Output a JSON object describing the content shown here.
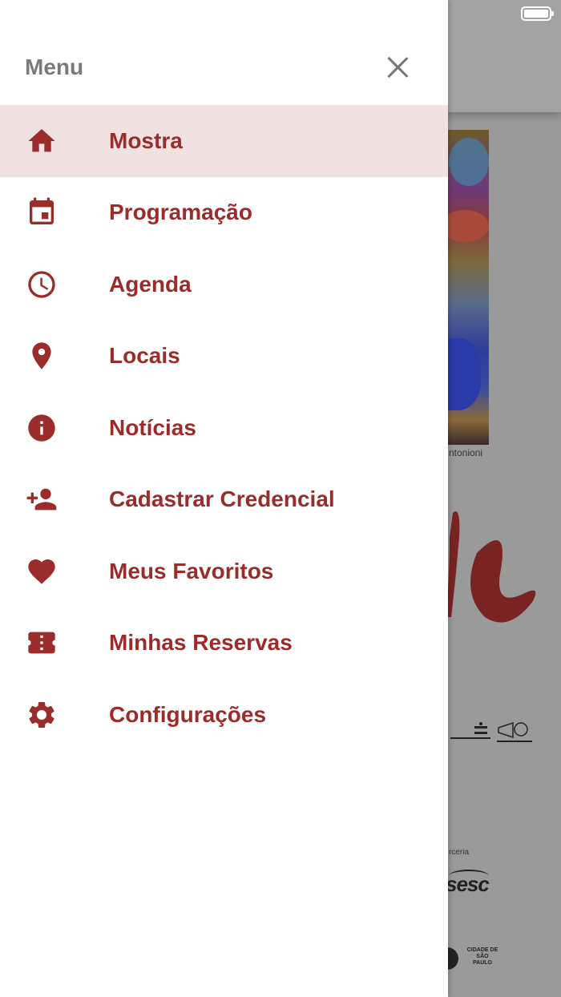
{
  "drawer": {
    "title": "Menu",
    "items": [
      {
        "label": "Mostra",
        "icon": "home-icon",
        "active": true
      },
      {
        "label": "Programação",
        "icon": "calendar-icon",
        "active": false
      },
      {
        "label": "Agenda",
        "icon": "clock-icon",
        "active": false
      },
      {
        "label": "Locais",
        "icon": "location-pin-icon",
        "active": false
      },
      {
        "label": "Notícias",
        "icon": "info-icon",
        "active": false
      },
      {
        "label": "Cadastrar Credencial",
        "icon": "add-user-icon",
        "active": false
      },
      {
        "label": "Meus Favoritos",
        "icon": "heart-icon",
        "active": false
      },
      {
        "label": "Minhas Reservas",
        "icon": "ticket-icon",
        "active": false
      },
      {
        "label": "Configurações",
        "icon": "gear-icon",
        "active": false
      }
    ]
  },
  "background": {
    "poster_caption": "ntonioni",
    "sponsor_label": "rceria",
    "sponsor_logo": "sesc",
    "footer_logo_text": "CIDADE DE SÃO PAULO"
  },
  "colors": {
    "accent": "#9b2c2c",
    "active_bg": "#f1e2e2",
    "overlay": "#9a9a9a"
  }
}
